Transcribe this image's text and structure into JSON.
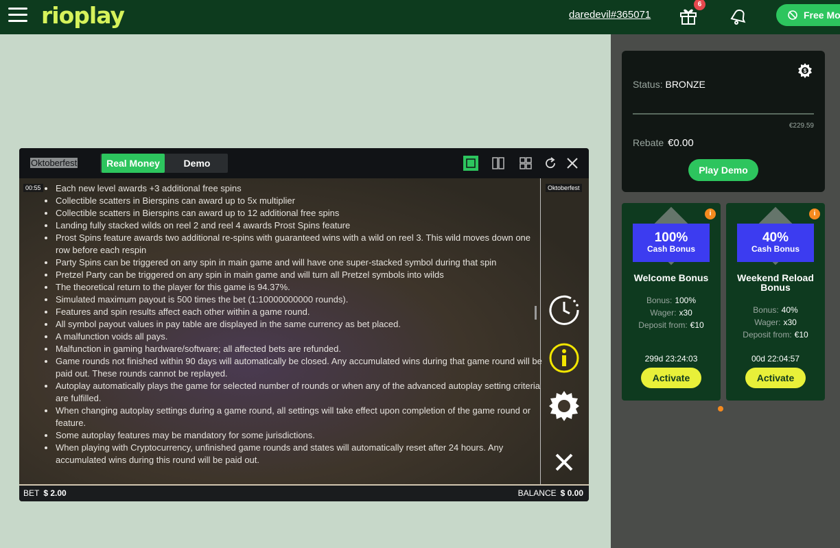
{
  "header": {
    "logo": "rioplay",
    "username": "daredevil#365071",
    "gift_badge": "6",
    "free_button": "Free Mo"
  },
  "status_card": {
    "status_label": "Status:",
    "status_value": "BRONZE",
    "progress_value": "€229.59",
    "rebate_label": "Rebate",
    "rebate_value": "€0.00",
    "play_demo": "Play Demo"
  },
  "bonuses": [
    {
      "badge_pct": "100%",
      "badge_sub": "Cash Bonus",
      "title": "Welcome Bonus",
      "bonus_label": "Bonus:",
      "bonus_value": "100%",
      "wager_label": "Wager:",
      "wager_value": "x30",
      "deposit_label": "Deposit from:",
      "deposit_value": "€10",
      "timer": "299d  23:24:03",
      "activate": "Activate",
      "info": "i"
    },
    {
      "badge_pct": "40%",
      "badge_sub": "Cash Bonus",
      "title": "Weekend Reload Bonus",
      "bonus_label": "Bonus:",
      "bonus_value": "40%",
      "wager_label": "Wager:",
      "wager_value": "x30",
      "deposit_label": "Deposit from:",
      "deposit_value": "€10",
      "timer": "00d  22:04:57",
      "activate": "Activate",
      "info": "i"
    }
  ],
  "game": {
    "title": "Oktoberfest",
    "tab_real": "Real Money",
    "tab_demo": "Demo",
    "timer": "00:55",
    "game_name": "Oktoberfest",
    "rules": [
      "Each new level awards +3 additional free spins",
      "Collectible scatters in Bierspins can award up to 5x multiplier",
      "Collectible scatters in Bierspins can award up to 12 additional free spins",
      "Landing fully stacked wilds on reel 2 and reel 4 awards Prost Spins feature",
      "Prost Spins feature awards two additional re-spins with guaranteed wins with a wild on reel 3. This wild moves down one row before each respin",
      "Party Spins can be triggered on any spin in main game and will have one super-stacked symbol during that spin",
      "Pretzel Party can be triggered on any spin in main game and will turn all Pretzel symbols into wilds",
      "The theoretical return to the player for this game is 94.37%.",
      "Simulated maximum payout is 500 times the bet (1:10000000000 rounds).",
      "Features and spin results affect each other within a game round.",
      "All symbol payout values in pay table are displayed in the same currency as bet placed.",
      "A malfunction voids all pays.",
      "Malfunction in gaming hardware/software; all affected bets are refunded.",
      "Game rounds not finished within 90 days will automatically be closed. Any accumulated wins during that game round will be paid out. These rounds cannot be replayed.",
      "Autoplay automatically plays the game for selected number of rounds or when any of the advanced autoplay setting criteria are fulfilled.",
      "When changing autoplay settings during a game round, all settings will take effect upon completion of the game round or feature.",
      "Some autoplay features may be mandatory for some jurisdictions.",
      "When playing with Cryptocurrency, unfinished game rounds and states will automatically reset after 24 hours. Any accumulated wins during this round will be paid out."
    ],
    "bet_label": "BET",
    "bet_value": "$ 2.00",
    "balance_label": "BALANCE",
    "balance_value": "$ 0.00"
  },
  "colors": {
    "topbar": "#0d3b1e",
    "accent_green": "#2dc55e",
    "logo": "#d6f25b",
    "activate_yellow": "#e8f039",
    "badge_blue": "#3c3cf0",
    "info_orange": "#f58a1f"
  },
  "icons": [
    "menu-icon",
    "gift-icon",
    "bell-icon",
    "free-spin-icon",
    "settings-coin-icon",
    "single-view-icon",
    "split-view-icon",
    "grid-view-icon",
    "refresh-icon",
    "close-icon",
    "history-icon",
    "info-icon",
    "gear-icon",
    "close-rules-icon"
  ]
}
